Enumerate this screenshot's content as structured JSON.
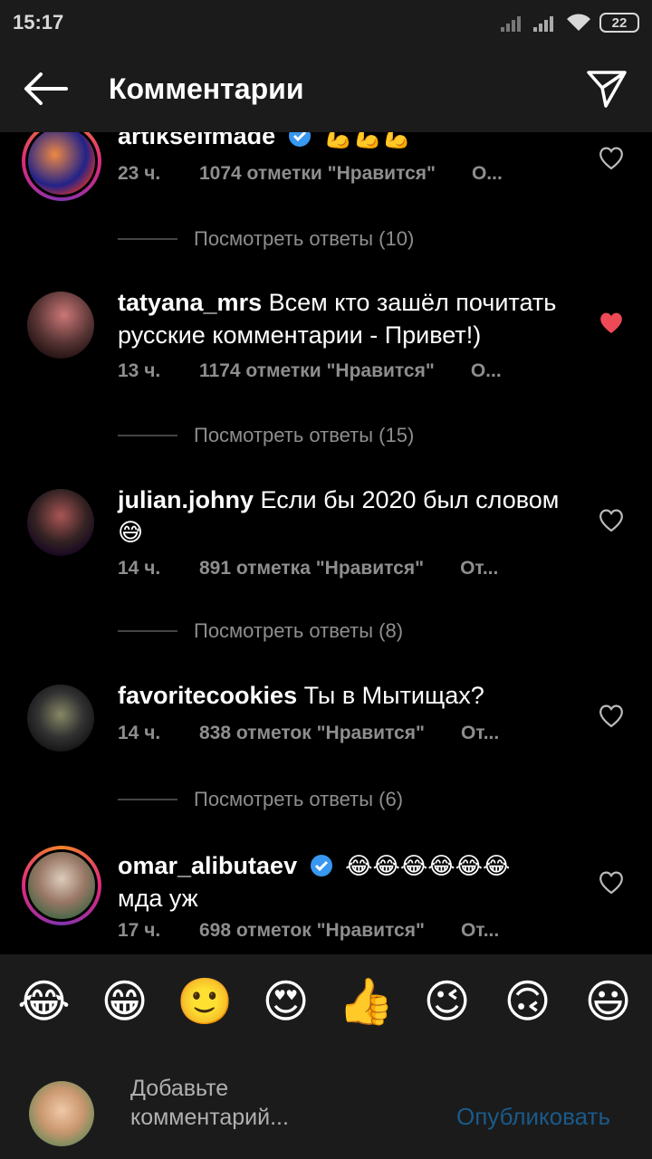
{
  "status": {
    "time": "15:17",
    "battery": "22"
  },
  "header": {
    "title": "Комментарии"
  },
  "comments": [
    {
      "username": "artikselfmade",
      "text": "💪💪💪",
      "age": "23 ч.",
      "likes": "1074 отметки \"Нравится\"",
      "reply": "О...",
      "view_replies": "Посмотреть ответы (10)",
      "liked": false
    },
    {
      "username": "tatyana_mrs",
      "text": "Всем кто зашёл почитать русские комментарии - Привет!)",
      "age": "13 ч.",
      "likes": "1174 отметки \"Нравится\"",
      "reply": "О...",
      "view_replies": "Посмотреть ответы (15)",
      "liked": true
    },
    {
      "username": "julian.johny",
      "text": "Если бы 2020 был словом 😅",
      "age": "14 ч.",
      "likes": "891 отметка \"Нравится\"",
      "reply": "От...",
      "view_replies": "Посмотреть ответы (8)",
      "liked": false
    },
    {
      "username": "favoritecookies",
      "text": "Ты в Мытищах?",
      "age": "14 ч.",
      "likes": "838 отметок \"Нравится\"",
      "reply": "От...",
      "view_replies": "Посмотреть ответы (6)",
      "liked": false
    },
    {
      "username": "omar_alibutaev",
      "text": "😂😂😂😂😂😂",
      "text2": "мда уж",
      "age": "17 ч.",
      "likes": "698 отметок \"Нравится\"",
      "reply": "От...",
      "liked": false
    }
  ],
  "emoji_bar": [
    "😂",
    "😁",
    "🙂",
    "😍",
    "👍",
    "😉",
    "🙃",
    "😃"
  ],
  "input": {
    "placeholder": "Добавьте комментарий...",
    "publish": "Опубликовать"
  },
  "colors": {
    "liked_heart": "#ed4956",
    "secondary_text": "#8e8e8e",
    "publish_disabled": "#1a5a8a"
  }
}
